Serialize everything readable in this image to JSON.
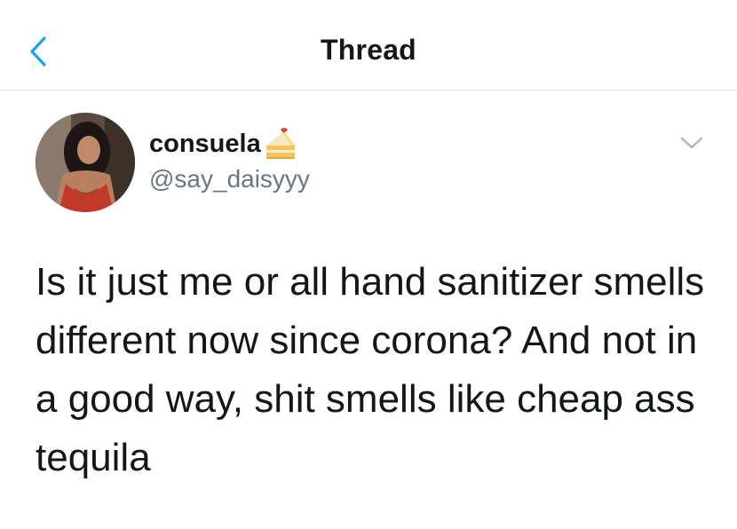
{
  "header": {
    "title": "Thread",
    "back_icon": "chevron-left-icon",
    "accent_color": "#1da1f2"
  },
  "tweet": {
    "author": {
      "display_name": "consuela",
      "name_emoji": "cake-icon",
      "handle": "@say_daisyyy"
    },
    "more_icon": "chevron-down-icon",
    "text": "Is it just me or all hand sanitizer smells different now since corona? And not in a good way, shit smells like cheap ass tequila"
  }
}
